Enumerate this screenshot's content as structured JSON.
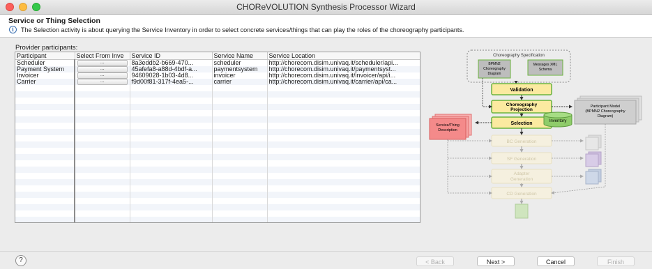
{
  "window": {
    "title": "CHOReVOLUTION Synthesis Processor Wizard"
  },
  "header": {
    "title": "Service or Thing Selection",
    "description": "The Selection activity is about querying the Service Inventory in order to select concrete services/things that can play the roles of the choreography participants."
  },
  "table": {
    "label": "Provider participants:",
    "columns": [
      "Participant",
      "Select From Inve",
      "Service ID",
      "Service Name",
      "Service Location"
    ],
    "rows": [
      {
        "participant": "Scheduler",
        "select": "...",
        "service_id": "8a3eddb2-b669-470...",
        "service_name": "scheduler",
        "service_location": "http://chorecom.disim.univaq.it/scheduler/api..."
      },
      {
        "participant": "Payment System",
        "select": "...",
        "service_id": "45afefa8-a88d-4bdf-a...",
        "service_name": "paymentsystem",
        "service_location": "http://chorecom.disim.univaq.it/paymentsyst..."
      },
      {
        "participant": "Invoicer",
        "select": "...",
        "service_id": "94609028-1b03-4d8...",
        "service_name": "invoicer",
        "service_location": "http://chorecom.disim.univaq.it/invoicer/api/i..."
      },
      {
        "participant": "Carrier",
        "select": "...",
        "service_id": "f9d00f81-317f-4ea5-...",
        "service_name": "carrier",
        "service_location": "http://chorecom.disim.univaq.it/carrier/api/ca..."
      }
    ]
  },
  "diagram": {
    "spec_title": "Choreography Specification",
    "bpmn_label": [
      "BPMN2",
      "Choreography",
      "Diagram"
    ],
    "xml_label": [
      "Messages XML",
      "Schema"
    ],
    "steps": {
      "validation": "Validation",
      "projection": [
        "Choreography",
        "Projection"
      ],
      "selection": "Selection",
      "bc": "BC Generation",
      "sf": "SF Generation",
      "adapter": [
        "Adapter",
        "Generation"
      ],
      "cd": "CD Generation"
    },
    "inventory": "Inventory",
    "participant_model": [
      "Participant Model",
      "(BPMN2 Choreography",
      "Diagram)"
    ],
    "service_desc": [
      "Service/Thing",
      "Description"
    ]
  },
  "buttons": {
    "back": "< Back",
    "next": "Next >",
    "cancel": "Cancel",
    "finish": "Finish"
  },
  "help": {
    "icon_glyph": "?"
  },
  "icons": [
    "info-icon",
    "help-icon"
  ],
  "colors": {
    "step_active": "#fbeaa0",
    "step_border": "#6bb33e",
    "step_faded": "#fdf5d6",
    "service_desc": "#f48a8a",
    "inventory": "#8fcc6a"
  }
}
